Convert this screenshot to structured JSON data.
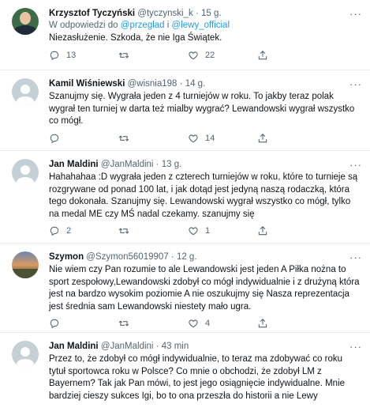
{
  "tweets": [
    {
      "name": "Krzysztof Tyczyński",
      "handle": "@tyczynski_k",
      "time": "15 g.",
      "reply_prefix": "W odpowiedzi do",
      "mention1": "@przeglad",
      "reply_and": "i",
      "mention2": "@lewy_official",
      "text": "Niezasłużenie. Szkoda, że nie Iga Świątek.",
      "replies": "13",
      "retweets": "",
      "likes": "22",
      "avatar": "photo"
    },
    {
      "name": "Kamil Wiśniewski",
      "handle": "@wisnia198",
      "time": "14 g.",
      "text": "Szanujmy się. Wygrała jeden z 4 turniejów w roku. To jakby teraz polak wygrał ten turniej w darta też mialby wygrać? Lewandowski wygrał wszystko co mógł.",
      "replies": "",
      "retweets": "",
      "likes": "14",
      "avatar": "default"
    },
    {
      "name": "Jan Maldini",
      "handle": "@JanMaldini",
      "time": "13 g.",
      "text": "Hahahahaa :D wygrała jeden z czterech turniejów w roku, które to turnieje są rozgrywane od ponad 100 lat, i jak dotąd jest jedyną naszą rodaczką, która tego dokonała. Szanujmy się. Lewandowski wygrał wszystko co mógł, tylko na medal ME czy MŚ nadal czekamy. szanujmy się",
      "replies": "2",
      "retweets": "",
      "likes": "1",
      "avatar": "default"
    },
    {
      "name": "Szymon",
      "handle": "@Szymon56019907",
      "time": "12 g.",
      "text": "Nie wiem czy Pan rozumie to ale Lewandowski jest jeden A Piłka  nożna to sport zespołowy,Lewandowski zdobył co mógł indywidualnie i z drużyną która jest na bardzo wysokim poziomie A nie oszukujmy się Nasza reprezentacja jest średnia sam Lewandowski niestety mało ugra.",
      "replies": "",
      "retweets": "",
      "likes": "4",
      "avatar": "sunset"
    },
    {
      "name": "Jan Maldini",
      "handle": "@JanMaldini",
      "time": "43 min",
      "text": "Przez to, że zdobył co mógł indywidualnie, to teraz ma zdobywać co roku tytuł sportowca roku w Polsce? Co mnie o obchodzi, że zdobył LM z Bayernem? Tak jak Pan mówi, to jest jego osiągnięcie indywidualne. Mnie bardziej cieszy sukces Igi, bo to ona przeszła do historii a nie Lewy",
      "replies": "",
      "retweets": "",
      "likes": "",
      "avatar": "default"
    }
  ],
  "ui": {
    "separator": "·",
    "more": "···"
  }
}
